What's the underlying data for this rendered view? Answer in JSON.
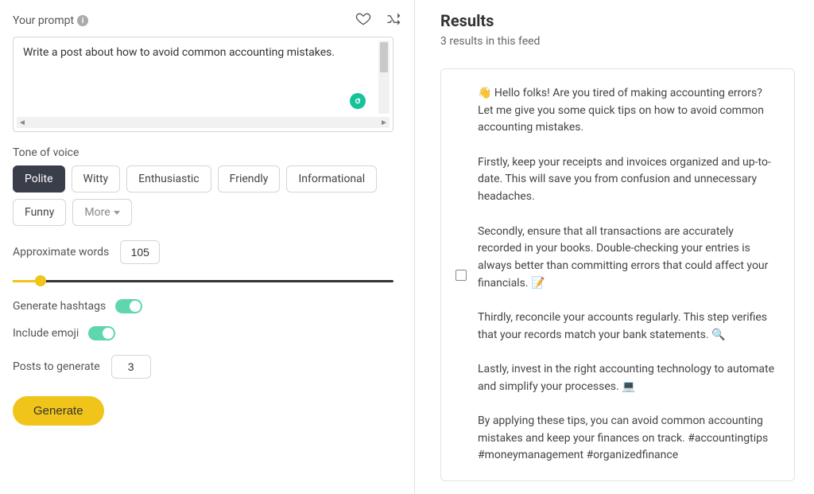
{
  "prompt": {
    "label": "Your prompt",
    "text": "Write a post about how to avoid common accounting mistakes."
  },
  "tone": {
    "label": "Tone of voice",
    "options": [
      "Polite",
      "Witty",
      "Enthusiastic",
      "Friendly",
      "Informational",
      "Funny"
    ],
    "more_label": "More",
    "active_index": 0
  },
  "approx_words": {
    "label": "Approximate words",
    "value": "105"
  },
  "hashtags": {
    "label": "Generate hashtags",
    "on": true
  },
  "emoji": {
    "label": "Include emoji",
    "on": true
  },
  "posts": {
    "label": "Posts to generate",
    "value": "3"
  },
  "generate_label": "Generate",
  "results": {
    "title": "Results",
    "subtitle": "3 results in this feed",
    "items": [
      "👋 Hello folks! Are you tired of making accounting errors? Let me give you some quick tips on how to avoid common accounting mistakes.\n\nFirstly, keep your receipts and invoices organized and up-to-date. This will save you from confusion and unnecessary headaches.\n\nSecondly, ensure that all transactions are accurately recorded in your books. Double-checking your entries is always better than committing errors that could affect your financials. 📝\n\nThirdly, reconcile your accounts regularly. This step verifies that your records match your bank statements. 🔍\n\nLastly, invest in the right accounting technology to automate and simplify your processes. 💻\n\nBy applying these tips, you can avoid common accounting mistakes and keep your finances on track. #accountingtips #moneymanagement #organizedfinance"
    ]
  }
}
